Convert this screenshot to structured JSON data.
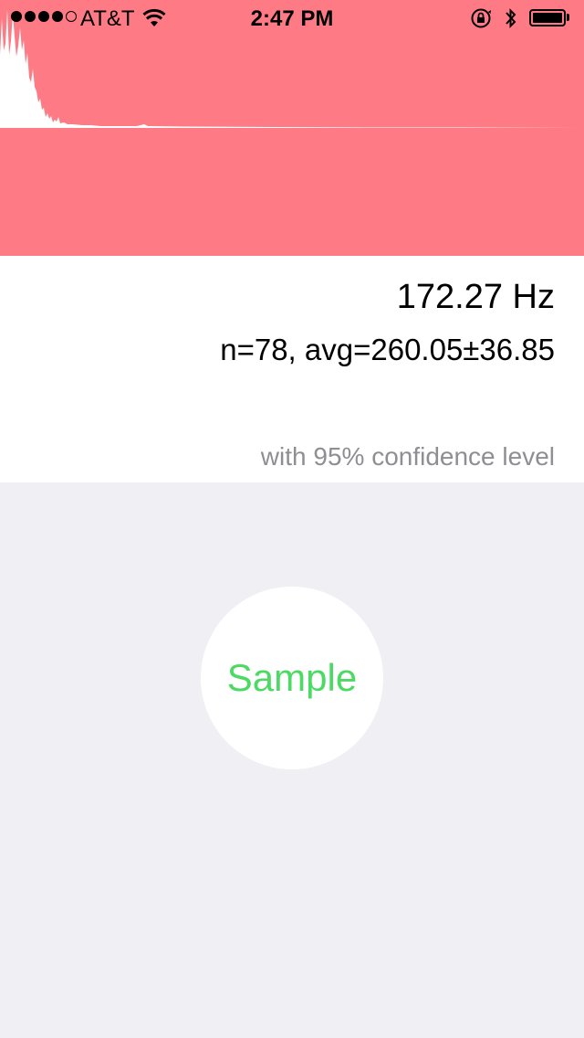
{
  "status_bar": {
    "carrier": "AT&T",
    "time": "2:47 PM",
    "signal_bars_filled": 4,
    "signal_bars_total": 5,
    "battery_level": 1.0,
    "icons": [
      "signal-dots-icon",
      "wifi-icon",
      "rotation-lock-icon",
      "bluetooth-icon",
      "battery-icon"
    ]
  },
  "spectrum": {
    "background_color": "#fe7a85",
    "fill_color": "#ffffff"
  },
  "readout": {
    "frequency": "172.27 Hz",
    "stats": "n=78, avg=260.05±36.85",
    "confidence": "with 95% confidence level"
  },
  "sample_button": {
    "label": "Sample",
    "label_color": "#4cd964"
  },
  "colors": {
    "panel_red": "#fe7a85",
    "background": "#efeff4",
    "secondary_text": "#8e8e93"
  }
}
